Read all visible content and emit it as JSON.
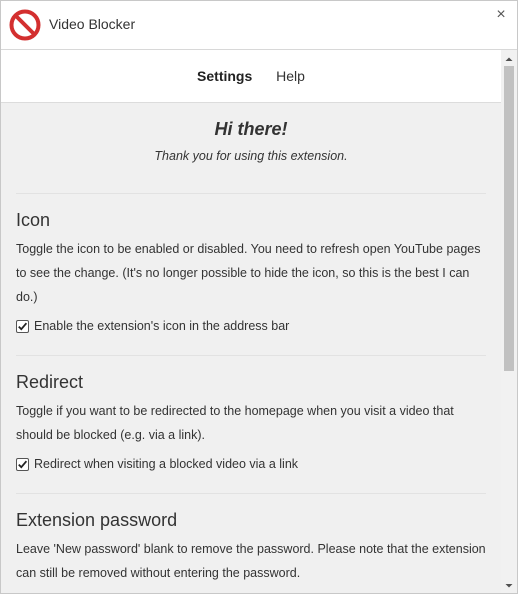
{
  "window": {
    "title": "Video Blocker",
    "app_icon": "no-entry-sign-icon",
    "close_icon": "close-icon",
    "close_glyph": "×",
    "accent_color": "#d32f2f"
  },
  "nav": {
    "tabs": [
      {
        "label": "Settings",
        "active": true
      },
      {
        "label": "Help",
        "active": false
      }
    ]
  },
  "hero": {
    "title": "Hi there!",
    "subtitle": "Thank you for using this extension."
  },
  "sections": {
    "icon": {
      "title": "Icon",
      "description": "Toggle the icon to be enabled or disabled. You need to refresh open YouTube pages to see the change. (It's no longer possible to hide the icon, so this is the best I can do.)",
      "checkbox_label": "Enable the extension's icon in the address bar",
      "checked": true
    },
    "redirect": {
      "title": "Redirect",
      "description": "Toggle if you want to be redirected to the homepage when you visit a video that should be blocked (e.g. via a link).",
      "checkbox_label": "Redirect when visiting a blocked video via a link",
      "checked": true
    },
    "password": {
      "title": "Extension password",
      "description": "Leave 'New password' blank to remove the password. Please note that the extension can still be removed without entering the password."
    }
  },
  "scrollbar": {
    "position_fraction": 0.0
  }
}
